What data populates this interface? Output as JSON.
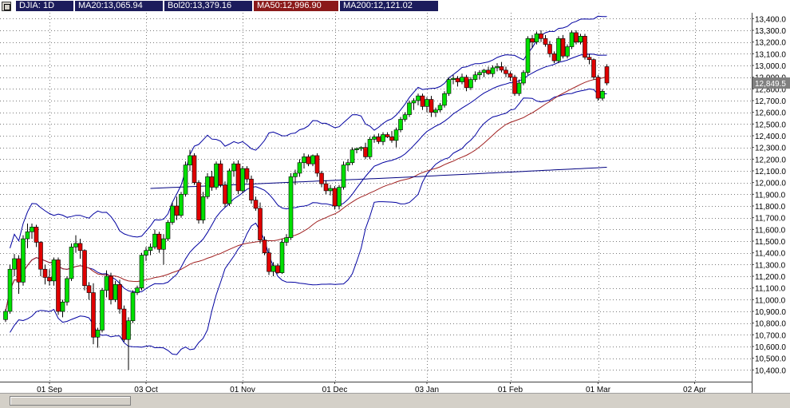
{
  "legend": {
    "symbol": "DJIA: 1D",
    "ma20": "MA20:13,065.94",
    "bol20": "Bol20:13,379.16",
    "ma50": "MA50:12,996.90",
    "ma200": "MA200:12,121.02"
  },
  "last_price_label": "12,849.5",
  "colors": {
    "up": "#00e000",
    "down": "#e00000",
    "bands": "#0000a0",
    "ma50": "#a02020",
    "ma200": "#000080",
    "grid": "#7a7a7a"
  },
  "chart_data": {
    "type": "candlestick",
    "ylim": [
      10300,
      13450
    ],
    "yticks": [
      10400,
      10500,
      10600,
      10700,
      10800,
      10900,
      11000,
      11100,
      11200,
      11300,
      11400,
      11500,
      11600,
      11700,
      11800,
      11900,
      12000,
      12100,
      12200,
      12300,
      12400,
      12500,
      12600,
      12700,
      12800,
      12900,
      13000,
      13100,
      13200,
      13300,
      13400
    ],
    "ytick_labels": [
      "10,400.0",
      "10,500.0",
      "10,600.0",
      "10,700.0",
      "10,800.0",
      "10,900.0",
      "11,000.0",
      "11,100.0",
      "11,200.0",
      "11,300.0",
      "11,400.0",
      "11,500.0",
      "11,600.0",
      "11,700.0",
      "11,800.0",
      "11,900.0",
      "12,000.0",
      "12,100.0",
      "12,200.0",
      "12,300.0",
      "12,400.0",
      "12,500.0",
      "12,600.0",
      "12,700.0",
      "12,800.0",
      "12,900.0",
      "13,000.0",
      "13,100.0",
      "13,200.0",
      "13,300.0",
      "13,400.0"
    ],
    "xticks": [
      {
        "label": "01 Sep",
        "index": 10
      },
      {
        "label": "03 Oct",
        "index": 32
      },
      {
        "label": "01 Nov",
        "index": 54
      },
      {
        "label": "01 Dec",
        "index": 75
      },
      {
        "label": "03 Jan",
        "index": 96
      },
      {
        "label": "01 Feb",
        "index": 115
      },
      {
        "label": "01 Mar",
        "index": 135
      },
      {
        "label": "02 Apr",
        "index": 157
      }
    ],
    "candles": [
      {
        "o": 10830,
        "h": 10920,
        "l": 10810,
        "c": 10900
      },
      {
        "o": 10900,
        "h": 11300,
        "l": 10880,
        "c": 11260
      },
      {
        "o": 11260,
        "h": 11390,
        "l": 11200,
        "c": 11350
      },
      {
        "o": 11350,
        "h": 11380,
        "l": 11050,
        "c": 11150
      },
      {
        "o": 11150,
        "h": 11550,
        "l": 11120,
        "c": 11520
      },
      {
        "o": 11520,
        "h": 11650,
        "l": 11440,
        "c": 11580
      },
      {
        "o": 11580,
        "h": 11650,
        "l": 11520,
        "c": 11620
      },
      {
        "o": 11620,
        "h": 11640,
        "l": 11450,
        "c": 11490
      },
      {
        "o": 11490,
        "h": 11500,
        "l": 11200,
        "c": 11260
      },
      {
        "o": 11260,
        "h": 11300,
        "l": 11130,
        "c": 11190
      },
      {
        "o": 11190,
        "h": 11260,
        "l": 11120,
        "c": 11160
      },
      {
        "o": 11160,
        "h": 11360,
        "l": 11120,
        "c": 11340
      },
      {
        "o": 11340,
        "h": 11360,
        "l": 10870,
        "c": 10900
      },
      {
        "o": 10900,
        "h": 11000,
        "l": 10850,
        "c": 10980
      },
      {
        "o": 10980,
        "h": 11200,
        "l": 10950,
        "c": 11180
      },
      {
        "o": 11180,
        "h": 11480,
        "l": 11160,
        "c": 11450
      },
      {
        "o": 11450,
        "h": 11550,
        "l": 11400,
        "c": 11480
      },
      {
        "o": 11480,
        "h": 11520,
        "l": 11350,
        "c": 11420
      },
      {
        "o": 11420,
        "h": 11430,
        "l": 11080,
        "c": 11120
      },
      {
        "o": 11120,
        "h": 11150,
        "l": 11000,
        "c": 11060
      },
      {
        "o": 11060,
        "h": 11140,
        "l": 10620,
        "c": 10680
      },
      {
        "o": 10680,
        "h": 10760,
        "l": 10590,
        "c": 10740
      },
      {
        "o": 10740,
        "h": 11100,
        "l": 10720,
        "c": 11080
      },
      {
        "o": 11080,
        "h": 11250,
        "l": 11020,
        "c": 11200
      },
      {
        "o": 11200,
        "h": 11230,
        "l": 10960,
        "c": 11000
      },
      {
        "o": 11000,
        "h": 11160,
        "l": 10980,
        "c": 11130
      },
      {
        "o": 11130,
        "h": 11170,
        "l": 10880,
        "c": 10920
      },
      {
        "o": 10920,
        "h": 10950,
        "l": 10640,
        "c": 10660
      },
      {
        "o": 10660,
        "h": 10850,
        "l": 10400,
        "c": 10820
      },
      {
        "o": 10820,
        "h": 11080,
        "l": 10800,
        "c": 11060
      },
      {
        "o": 11060,
        "h": 11120,
        "l": 11040,
        "c": 11100
      },
      {
        "o": 11100,
        "h": 11400,
        "l": 11080,
        "c": 11380
      },
      {
        "o": 11380,
        "h": 11450,
        "l": 11330,
        "c": 11420
      },
      {
        "o": 11420,
        "h": 11480,
        "l": 11380,
        "c": 11450
      },
      {
        "o": 11450,
        "h": 11600,
        "l": 11430,
        "c": 11560
      },
      {
        "o": 11560,
        "h": 11580,
        "l": 11400,
        "c": 11430
      },
      {
        "o": 11430,
        "h": 11560,
        "l": 11300,
        "c": 11520
      },
      {
        "o": 11520,
        "h": 11680,
        "l": 11500,
        "c": 11660
      },
      {
        "o": 11660,
        "h": 11830,
        "l": 11640,
        "c": 11800
      },
      {
        "o": 11800,
        "h": 11880,
        "l": 11680,
        "c": 11720
      },
      {
        "o": 11720,
        "h": 11920,
        "l": 11700,
        "c": 11900
      },
      {
        "o": 11900,
        "h": 12180,
        "l": 11880,
        "c": 12150
      },
      {
        "o": 12150,
        "h": 12280,
        "l": 12100,
        "c": 12230
      },
      {
        "o": 12230,
        "h": 12250,
        "l": 11980,
        "c": 12000
      },
      {
        "o": 12000,
        "h": 12020,
        "l": 11650,
        "c": 11680
      },
      {
        "o": 11680,
        "h": 11920,
        "l": 11650,
        "c": 11880
      },
      {
        "o": 11880,
        "h": 12080,
        "l": 11860,
        "c": 12050
      },
      {
        "o": 12050,
        "h": 12100,
        "l": 11930,
        "c": 11960
      },
      {
        "o": 11960,
        "h": 12180,
        "l": 11940,
        "c": 12160
      },
      {
        "o": 12160,
        "h": 12190,
        "l": 11960,
        "c": 11980
      },
      {
        "o": 11980,
        "h": 12010,
        "l": 11790,
        "c": 11820
      },
      {
        "o": 11820,
        "h": 12120,
        "l": 11800,
        "c": 12100
      },
      {
        "o": 12100,
        "h": 12180,
        "l": 12050,
        "c": 12160
      },
      {
        "o": 12160,
        "h": 12190,
        "l": 11900,
        "c": 11930
      },
      {
        "o": 11930,
        "h": 12140,
        "l": 11910,
        "c": 12120
      },
      {
        "o": 12120,
        "h": 12140,
        "l": 12000,
        "c": 12030
      },
      {
        "o": 12030,
        "h": 12060,
        "l": 11820,
        "c": 11850
      },
      {
        "o": 11850,
        "h": 11880,
        "l": 11760,
        "c": 11780
      },
      {
        "o": 11780,
        "h": 11830,
        "l": 11480,
        "c": 11510
      },
      {
        "o": 11510,
        "h": 11540,
        "l": 11380,
        "c": 11400
      },
      {
        "o": 11400,
        "h": 11440,
        "l": 11210,
        "c": 11240
      },
      {
        "o": 11240,
        "h": 11320,
        "l": 11200,
        "c": 11290
      },
      {
        "o": 11290,
        "h": 11310,
        "l": 11220,
        "c": 11230
      },
      {
        "o": 11230,
        "h": 11520,
        "l": 11220,
        "c": 11490
      },
      {
        "o": 11490,
        "h": 11560,
        "l": 11460,
        "c": 11530
      },
      {
        "o": 11530,
        "h": 12080,
        "l": 11510,
        "c": 12050
      },
      {
        "o": 12050,
        "h": 12110,
        "l": 11980,
        "c": 12080
      },
      {
        "o": 12080,
        "h": 12200,
        "l": 12050,
        "c": 12170
      },
      {
        "o": 12170,
        "h": 12250,
        "l": 12120,
        "c": 12220
      },
      {
        "o": 12220,
        "h": 12240,
        "l": 12140,
        "c": 12160
      },
      {
        "o": 12160,
        "h": 12240,
        "l": 12140,
        "c": 12230
      },
      {
        "o": 12230,
        "h": 12250,
        "l": 12050,
        "c": 12080
      },
      {
        "o": 12080,
        "h": 12100,
        "l": 11960,
        "c": 11990
      },
      {
        "o": 11990,
        "h": 12020,
        "l": 11900,
        "c": 11930
      },
      {
        "o": 11930,
        "h": 11980,
        "l": 11890,
        "c": 11950
      },
      {
        "o": 11950,
        "h": 11970,
        "l": 11770,
        "c": 11800
      },
      {
        "o": 11800,
        "h": 11980,
        "l": 11770,
        "c": 11960
      },
      {
        "o": 11960,
        "h": 12180,
        "l": 11940,
        "c": 12150
      },
      {
        "o": 12150,
        "h": 12200,
        "l": 12100,
        "c": 12170
      },
      {
        "o": 12170,
        "h": 12300,
        "l": 12150,
        "c": 12280
      },
      {
        "o": 12280,
        "h": 12300,
        "l": 12250,
        "c": 12290
      },
      {
        "o": 12290,
        "h": 12310,
        "l": 12270,
        "c": 12300
      },
      {
        "o": 12300,
        "h": 12340,
        "l": 12200,
        "c": 12220
      },
      {
        "o": 12220,
        "h": 12390,
        "l": 12200,
        "c": 12370
      },
      {
        "o": 12370,
        "h": 12410,
        "l": 12340,
        "c": 12390
      },
      {
        "o": 12390,
        "h": 12420,
        "l": 12330,
        "c": 12350
      },
      {
        "o": 12350,
        "h": 12430,
        "l": 12320,
        "c": 12410
      },
      {
        "o": 12410,
        "h": 12430,
        "l": 12380,
        "c": 12390
      },
      {
        "o": 12390,
        "h": 12440,
        "l": 12340,
        "c": 12360
      },
      {
        "o": 12360,
        "h": 12470,
        "l": 12300,
        "c": 12450
      },
      {
        "o": 12450,
        "h": 12560,
        "l": 12430,
        "c": 12540
      },
      {
        "o": 12540,
        "h": 12600,
        "l": 12520,
        "c": 12580
      },
      {
        "o": 12580,
        "h": 12700,
        "l": 12560,
        "c": 12680
      },
      {
        "o": 12680,
        "h": 12720,
        "l": 12620,
        "c": 12700
      },
      {
        "o": 12700,
        "h": 12760,
        "l": 12660,
        "c": 12740
      },
      {
        "o": 12740,
        "h": 12760,
        "l": 12620,
        "c": 12650
      },
      {
        "o": 12650,
        "h": 12730,
        "l": 12600,
        "c": 12710
      },
      {
        "o": 12710,
        "h": 12740,
        "l": 12560,
        "c": 12600
      },
      {
        "o": 12600,
        "h": 12640,
        "l": 12560,
        "c": 12620
      },
      {
        "o": 12620,
        "h": 12680,
        "l": 12600,
        "c": 12660
      },
      {
        "o": 12660,
        "h": 12780,
        "l": 12640,
        "c": 12760
      },
      {
        "o": 12760,
        "h": 12900,
        "l": 12740,
        "c": 12880
      },
      {
        "o": 12880,
        "h": 12920,
        "l": 12840,
        "c": 12890
      },
      {
        "o": 12890,
        "h": 12910,
        "l": 12820,
        "c": 12860
      },
      {
        "o": 12860,
        "h": 12930,
        "l": 12840,
        "c": 12900
      },
      {
        "o": 12900,
        "h": 12920,
        "l": 12780,
        "c": 12810
      },
      {
        "o": 12810,
        "h": 12900,
        "l": 12790,
        "c": 12880
      },
      {
        "o": 12880,
        "h": 12950,
        "l": 12860,
        "c": 12920
      },
      {
        "o": 12920,
        "h": 12960,
        "l": 12880,
        "c": 12940
      },
      {
        "o": 12940,
        "h": 12970,
        "l": 12900,
        "c": 12960
      },
      {
        "o": 12960,
        "h": 12990,
        "l": 12920,
        "c": 12930
      },
      {
        "o": 12930,
        "h": 13000,
        "l": 12900,
        "c": 12980
      },
      {
        "o": 12980,
        "h": 13020,
        "l": 12950,
        "c": 12990
      },
      {
        "o": 12990,
        "h": 13030,
        "l": 12940,
        "c": 12960
      },
      {
        "o": 12960,
        "h": 12990,
        "l": 12900,
        "c": 12930
      },
      {
        "o": 12930,
        "h": 12950,
        "l": 12870,
        "c": 12900
      },
      {
        "o": 12900,
        "h": 12920,
        "l": 12740,
        "c": 12760
      },
      {
        "o": 12760,
        "h": 12880,
        "l": 12740,
        "c": 12850
      },
      {
        "o": 12850,
        "h": 12960,
        "l": 12830,
        "c": 12940
      },
      {
        "o": 12940,
        "h": 13250,
        "l": 12920,
        "c": 13230
      },
      {
        "o": 13230,
        "h": 13260,
        "l": 13150,
        "c": 13200
      },
      {
        "o": 13200,
        "h": 13290,
        "l": 13180,
        "c": 13270
      },
      {
        "o": 13270,
        "h": 13300,
        "l": 13200,
        "c": 13230
      },
      {
        "o": 13230,
        "h": 13260,
        "l": 13160,
        "c": 13180
      },
      {
        "o": 13180,
        "h": 13210,
        "l": 13070,
        "c": 13100
      },
      {
        "o": 13100,
        "h": 13120,
        "l": 13020,
        "c": 13040
      },
      {
        "o": 13040,
        "h": 13250,
        "l": 13020,
        "c": 13230
      },
      {
        "o": 13230,
        "h": 13260,
        "l": 13060,
        "c": 13080
      },
      {
        "o": 13080,
        "h": 13180,
        "l": 13060,
        "c": 13160
      },
      {
        "o": 13160,
        "h": 13300,
        "l": 13140,
        "c": 13280
      },
      {
        "o": 13280,
        "h": 13300,
        "l": 13180,
        "c": 13200
      },
      {
        "o": 13200,
        "h": 13270,
        "l": 13180,
        "c": 13250
      },
      {
        "o": 13250,
        "h": 13270,
        "l": 13050,
        "c": 13070
      },
      {
        "o": 13070,
        "h": 13100,
        "l": 13010,
        "c": 13050
      },
      {
        "o": 13050,
        "h": 13060,
        "l": 12880,
        "c": 12900
      },
      {
        "o": 12900,
        "h": 12920,
        "l": 12700,
        "c": 12720
      },
      {
        "o": 12720,
        "h": 12800,
        "l": 12700,
        "c": 12780
      },
      {
        "o": 12990,
        "h": 13010,
        "l": 12830,
        "c": 12850
      }
    ]
  }
}
